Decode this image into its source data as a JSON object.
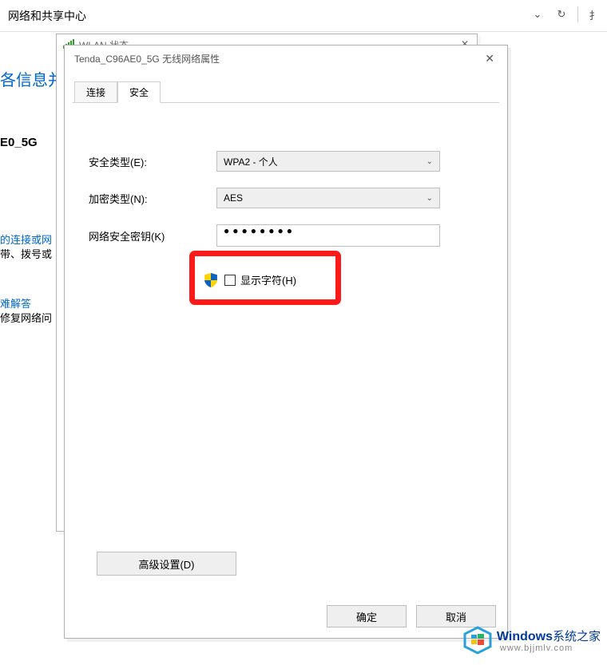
{
  "top": {
    "breadcrumb": "网络和共享中心",
    "search_cut": "扌"
  },
  "background": {
    "heading_cut": "各信息并",
    "e0_5g": "E0_5G",
    "conn1": "的连接或网",
    "conn2": "带、拨号或",
    "trouble1": "难解答",
    "trouble2": "修复网络问"
  },
  "wlan_window": {
    "title": "WLAN 状态"
  },
  "prop_dialog": {
    "title": "Tenda_C96AE0_5G 无线网络属性",
    "tabs": {
      "connect": "连接",
      "security": "安全"
    },
    "form": {
      "security_type_label": "安全类型(E):",
      "security_type_value": "WPA2 - 个人",
      "encryption_label": "加密类型(N):",
      "encryption_value": "AES",
      "key_label": "网络安全密钥(K)",
      "key_value": "●●●●●●●●",
      "show_chars_label": "显示字符(H)"
    },
    "advanced_button": "高级设置(D)",
    "ok": "确定",
    "cancel": "取消"
  },
  "watermark": {
    "brand_en": "Windows",
    "brand_cn": "系统之家",
    "url": "www.bjjmlv.com"
  }
}
